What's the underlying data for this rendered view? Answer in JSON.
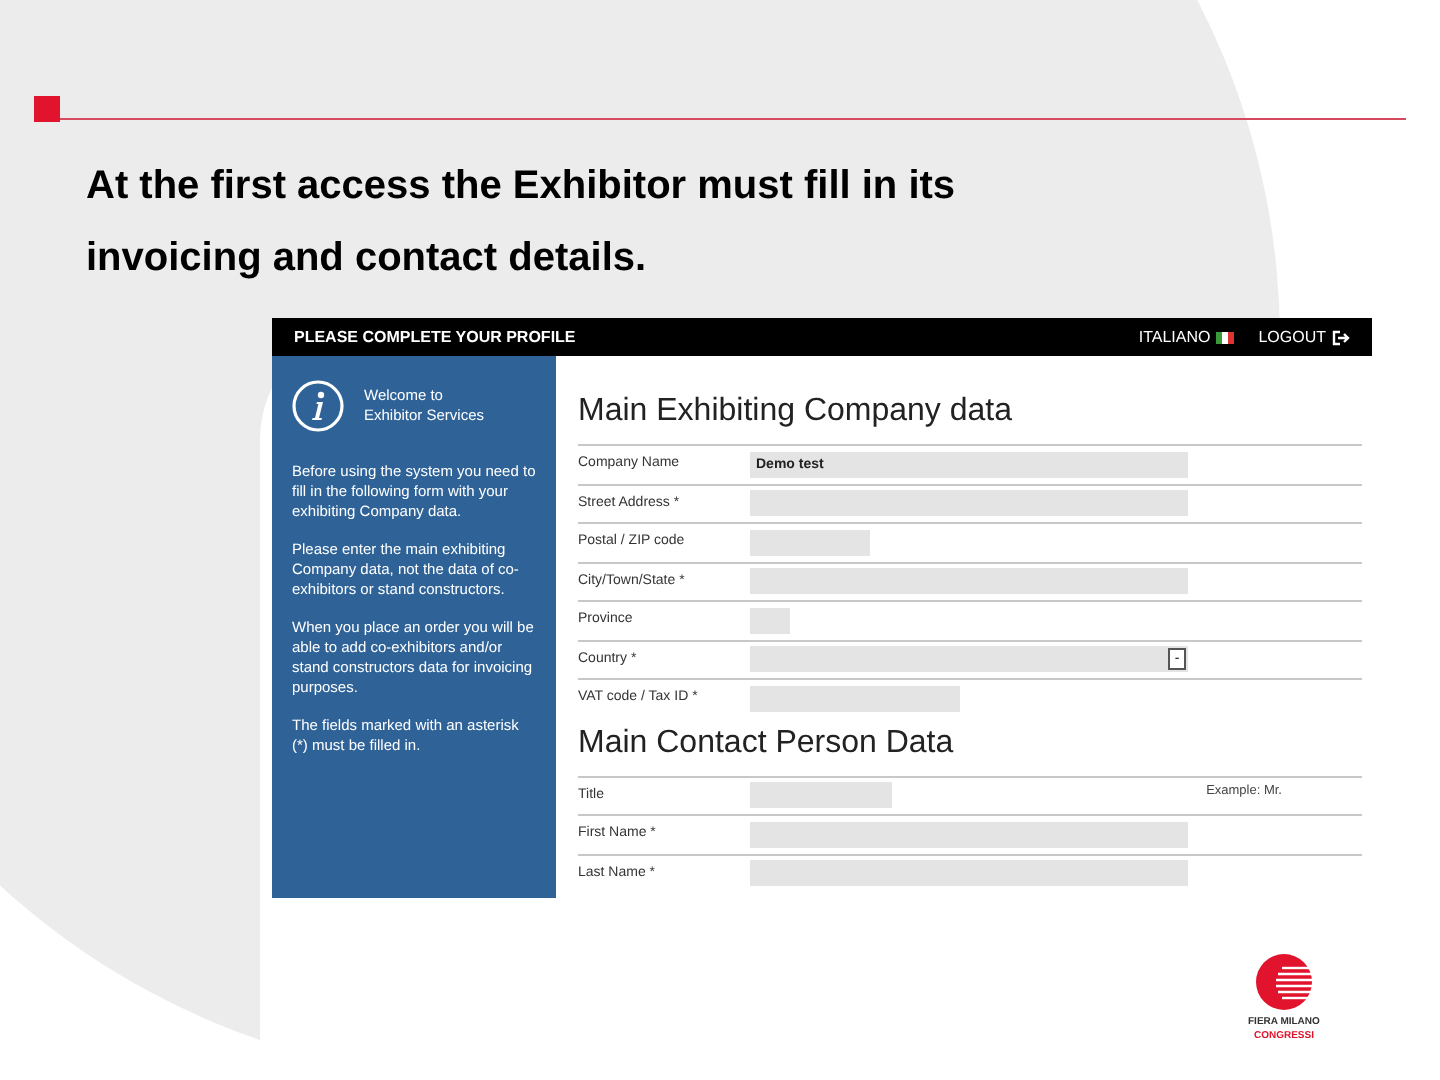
{
  "slide": {
    "heading": "At the first access the Exhibitor must fill in its invoicing and contact details."
  },
  "app": {
    "header": {
      "title": "PLEASE COMPLETE YOUR PROFILE",
      "language": "ITALIANO",
      "logout": "LOGOUT"
    },
    "sidebar": {
      "welcome": [
        "Welcome to",
        "Exhibitor Services"
      ],
      "paragraphs": [
        "Before using the system you need to fill in the following form with your exhibiting Company data.",
        "Please enter the main exhibiting Company data, not the data of co-exhibitors or stand constructors.",
        "When you place an order you will be able to add co-exhibitors and/or stand constructors data for invoicing purposes.",
        "The fields marked with an asterisk (*) must be filled in."
      ]
    },
    "sections": [
      {
        "title": "Main Exhibiting Company data",
        "fields": [
          {
            "label": "Company Name",
            "kind": "text",
            "value": "Demo test"
          },
          {
            "label": "Street Address *",
            "kind": "text"
          },
          {
            "label": "Postal / ZIP code",
            "kind": "text"
          },
          {
            "label": "City/Town/State *",
            "kind": "text"
          },
          {
            "label": "Province",
            "kind": "text"
          },
          {
            "label": "Country *",
            "kind": "select",
            "button": "-"
          },
          {
            "label": "VAT code / Tax ID *",
            "kind": "text"
          }
        ]
      },
      {
        "title": "Main Contact Person Data",
        "fields": [
          {
            "label": "Title",
            "kind": "text",
            "hint": "Example: Mr."
          },
          {
            "label": "First Name *",
            "kind": "text"
          },
          {
            "label": "Last Name *",
            "kind": "text"
          }
        ]
      }
    ]
  },
  "logo": {
    "lines": [
      "FIERA MILANO",
      "CONGRESSI"
    ]
  }
}
